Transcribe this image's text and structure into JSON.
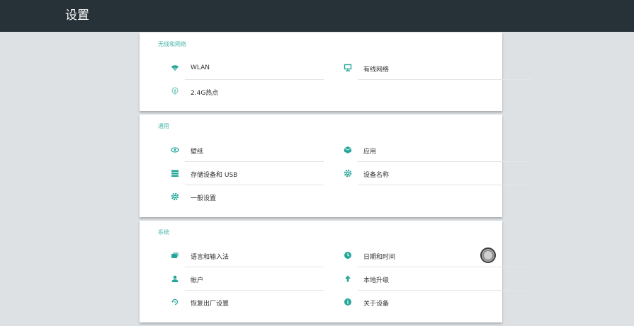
{
  "header": {
    "title": "设置"
  },
  "sections": [
    {
      "title": "无线和网络",
      "items": [
        {
          "label": "WLAN",
          "icon": "wifi-icon"
        },
        {
          "label": "有线网络",
          "icon": "ethernet-icon"
        },
        {
          "label": "2.4G热点",
          "icon": "hotspot-icon"
        }
      ]
    },
    {
      "title": "通用",
      "items": [
        {
          "label": "壁纸",
          "icon": "eye-icon"
        },
        {
          "label": "应用",
          "icon": "apps-icon"
        },
        {
          "label": "存储设备和 USB",
          "icon": "storage-icon"
        },
        {
          "label": "设备名称",
          "icon": "gear-icon"
        },
        {
          "label": "一般设置",
          "icon": "gear-icon"
        }
      ]
    },
    {
      "title": "系统",
      "items": [
        {
          "label": "语言和输入法",
          "icon": "keyboard-icon"
        },
        {
          "label": "日期和时间",
          "icon": "clock-icon"
        },
        {
          "label": "帐户",
          "icon": "account-icon"
        },
        {
          "label": "本地升级",
          "icon": "upgrade-icon"
        },
        {
          "label": "恢复出厂设置",
          "icon": "restore-icon"
        },
        {
          "label": "关于设备",
          "icon": "info-icon"
        }
      ]
    }
  ],
  "colors": {
    "accent": "#26a69a",
    "header_bg": "#263238",
    "page_bg": "#dde1e3"
  }
}
